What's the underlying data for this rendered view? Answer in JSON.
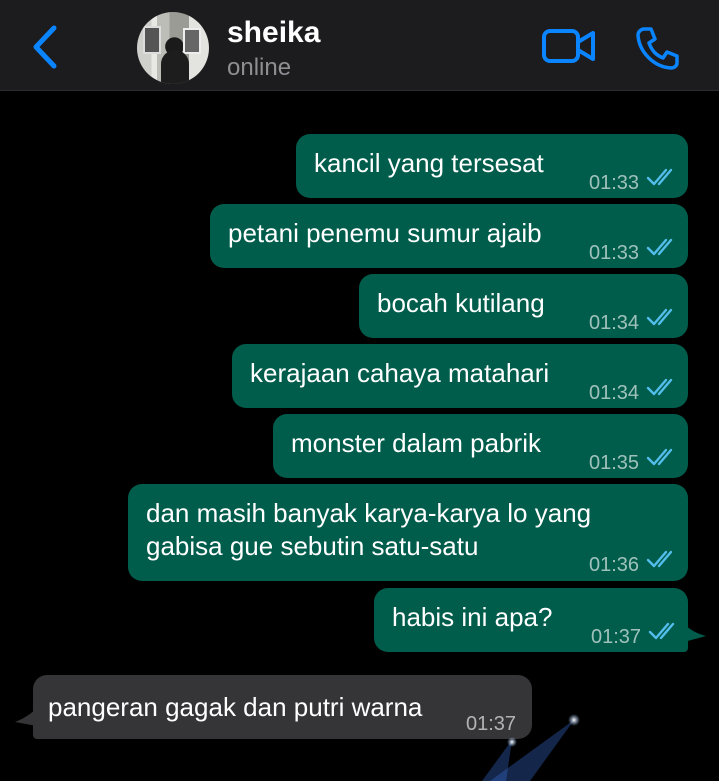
{
  "header": {
    "back_icon": "chevron-left-icon",
    "contact_name": "sheika",
    "contact_status": "online",
    "video_icon": "video-camera-icon",
    "call_icon": "phone-icon",
    "accent_color": "#0a84ff"
  },
  "messages": [
    {
      "direction": "outgoing",
      "text": "kancil yang tersesat",
      "time": "01:33",
      "read": true
    },
    {
      "direction": "outgoing",
      "text": "petani penemu sumur ajaib",
      "time": "01:33",
      "read": true
    },
    {
      "direction": "outgoing",
      "text": "bocah kutilang",
      "time": "01:34",
      "read": true
    },
    {
      "direction": "outgoing",
      "text": "kerajaan cahaya matahari",
      "time": "01:34",
      "read": true
    },
    {
      "direction": "outgoing",
      "text": "monster dalam pabrik",
      "time": "01:35",
      "read": true
    },
    {
      "direction": "outgoing",
      "text_line1": "dan masih banyak karya-karya lo yang",
      "text_line2": "gabisa gue sebutin satu-satu",
      "time": "01:36",
      "read": true
    },
    {
      "direction": "outgoing",
      "text": "habis ini apa?",
      "time": "01:37",
      "read": true
    },
    {
      "direction": "incoming",
      "text": "pangeran gagak dan putri warna",
      "time": "01:37"
    }
  ],
  "colors": {
    "outgoing_bubble": "#005c4b",
    "incoming_bubble": "#353537",
    "read_tick": "#53bdeb",
    "background": "#000000"
  }
}
